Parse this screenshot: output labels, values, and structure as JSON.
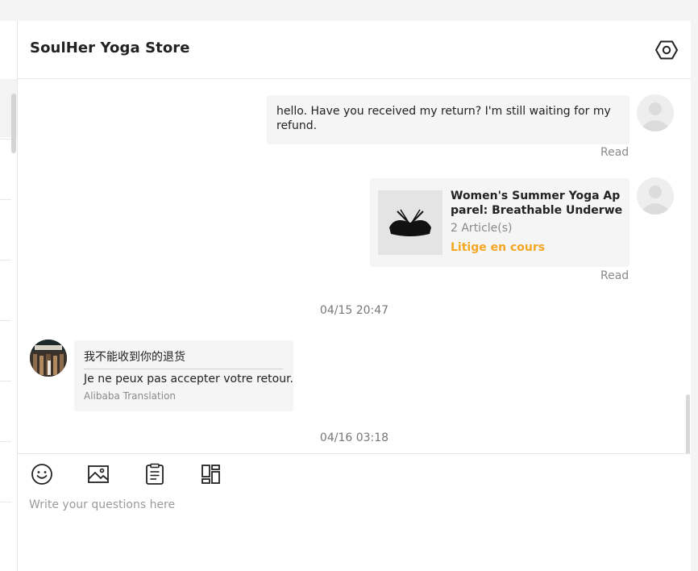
{
  "header": {
    "title": "SoulHer Yoga Store",
    "settings_icon": "settings-hexagon-icon"
  },
  "messages": {
    "outgoing_text": {
      "text": "hello. Have you received my return? I'm still waiting for my refund.",
      "status": "Read"
    },
    "outgoing_product": {
      "title": "Women's Summer Yoga Apparel: Breathable Underwear, Sp...",
      "count": "2 Article(s)",
      "status_label": "Litige en cours",
      "status": "Read"
    },
    "timestamp_1": "04/15 20:47",
    "incoming": {
      "original": "我不能收到你的退货",
      "translation": "Je ne peux pas accepter votre retour.",
      "translation_source": "Alibaba Translation"
    },
    "timestamp_2": "04/16 03:18"
  },
  "composer": {
    "placeholder": "Write your questions here",
    "tools": [
      "emoji-icon",
      "image-icon",
      "clipboard-icon",
      "layout-icon"
    ]
  },
  "colors": {
    "accent_status": "#f5a623",
    "bubble_bg": "#f5f5f5",
    "muted_text": "#8a8a8a"
  }
}
